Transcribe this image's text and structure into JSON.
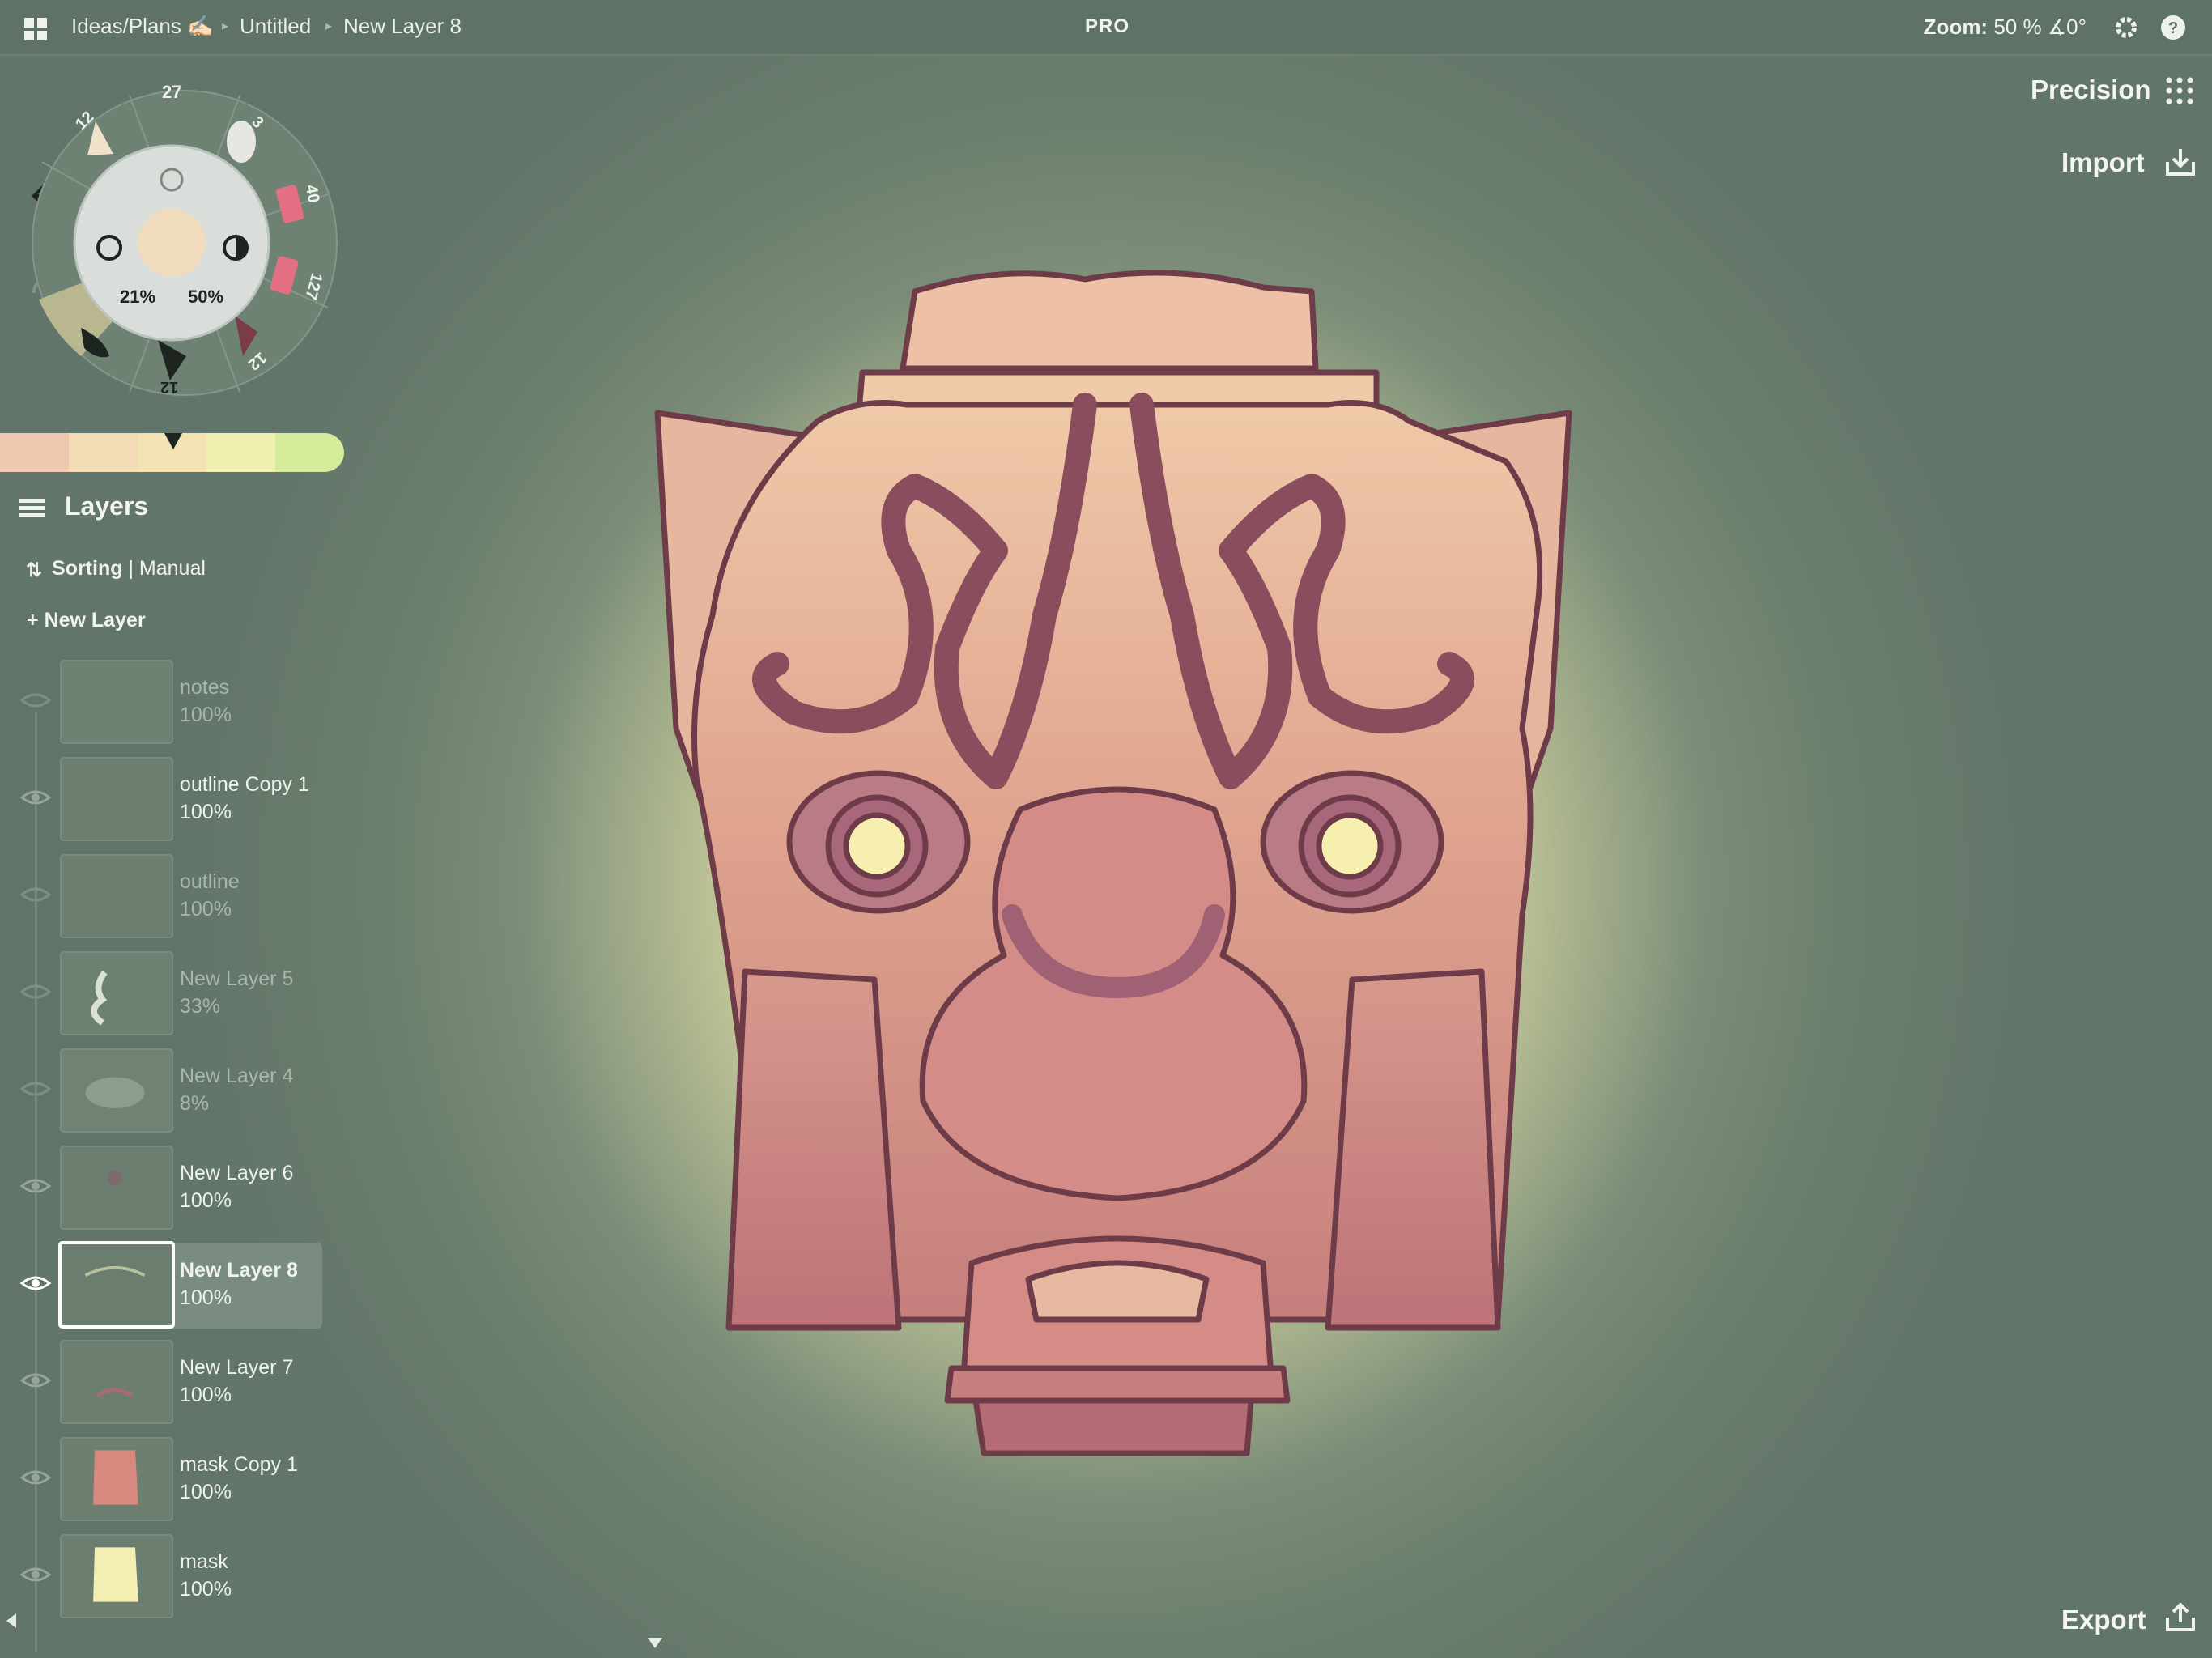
{
  "topbar": {
    "breadcrumb": [
      "Ideas/Plans ✍🏻",
      "Untitled",
      "New Layer 8"
    ],
    "center": "PRO",
    "zoom_label": "Zoom:",
    "zoom_value": "50 %",
    "rotation": "∡0°",
    "icons": [
      "grid-icon",
      "gear-icon",
      "help-icon"
    ]
  },
  "right_panel": {
    "precision": "Precision",
    "import": "Import",
    "export": "Export"
  },
  "tool_wheel": {
    "brush_sizes": [
      "27",
      "12",
      "3",
      "40",
      "127",
      "12",
      "12"
    ],
    "size_pct": "21%",
    "opacity_pct": "50%"
  },
  "color_strip": {
    "colors": [
      "#efc8b0",
      "#f3dcb6",
      "#f3e3b3",
      "#eff0b0",
      "#d5ec9a"
    ]
  },
  "layers": {
    "title": "Layers",
    "sorting_label": "Sorting",
    "sorting_value": "Manual",
    "new_layer": "New Layer",
    "items": [
      {
        "name": "notes",
        "opacity": "100%",
        "visible": false,
        "selected": false
      },
      {
        "name": "outline Copy 1",
        "opacity": "100%",
        "visible": true,
        "selected": false
      },
      {
        "name": "outline",
        "opacity": "100%",
        "visible": false,
        "selected": false
      },
      {
        "name": "New Layer 5",
        "opacity": "33%",
        "visible": false,
        "selected": false
      },
      {
        "name": "New Layer 4",
        "opacity": "8%",
        "visible": false,
        "selected": false
      },
      {
        "name": "New Layer 6",
        "opacity": "100%",
        "visible": true,
        "selected": false
      },
      {
        "name": "New Layer 8",
        "opacity": "100%",
        "visible": true,
        "selected": true
      },
      {
        "name": "New Layer 7",
        "opacity": "100%",
        "visible": true,
        "selected": false
      },
      {
        "name": "mask Copy 1",
        "opacity": "100%",
        "visible": true,
        "selected": false
      },
      {
        "name": "mask",
        "opacity": "100%",
        "visible": true,
        "selected": false
      }
    ]
  },
  "colors": {
    "background": "#6a7e6d",
    "accent": "#f7efb6",
    "outline": "#6e3b49"
  }
}
